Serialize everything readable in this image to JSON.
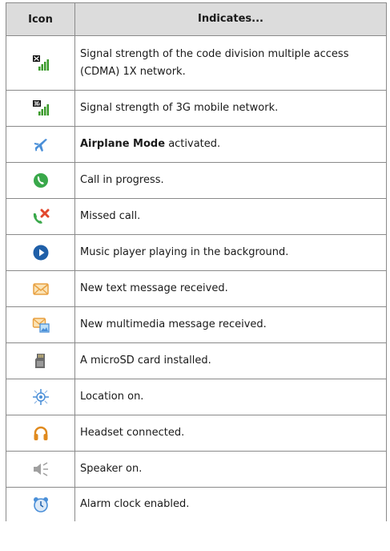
{
  "table": {
    "headers": {
      "icon": "Icon",
      "indicates": "Indicates..."
    },
    "rows": [
      {
        "icon": "cdma-1x-signal-icon",
        "text": "Signal strength of the code division multiple access (CDMA) 1X network."
      },
      {
        "icon": "3g-signal-icon",
        "text": "Signal strength of 3G mobile network."
      },
      {
        "icon": "airplane-mode-icon",
        "bold": "Airplane Mode",
        "text": " activated."
      },
      {
        "icon": "call-in-progress-icon",
        "text": "Call in progress."
      },
      {
        "icon": "missed-call-icon",
        "text": "Missed call."
      },
      {
        "icon": "music-playing-icon",
        "text": "Music player playing in the background."
      },
      {
        "icon": "text-message-icon",
        "text": "New text message received."
      },
      {
        "icon": "multimedia-message-icon",
        "text": "New multimedia message received."
      },
      {
        "icon": "microsd-card-icon",
        "text": "A microSD card installed."
      },
      {
        "icon": "location-icon",
        "text": "Location on."
      },
      {
        "icon": "headset-icon",
        "text": "Headset connected."
      },
      {
        "icon": "speaker-icon",
        "text": "Speaker on."
      },
      {
        "icon": "alarm-clock-icon",
        "text": "Alarm clock enabled."
      }
    ]
  },
  "colors": {
    "header_bg": "#dcdcdc",
    "border": "#8a8a8a",
    "signal_green": "#3a9a2a",
    "airplane_blue": "#4a8fd8",
    "call_green": "#39a84a",
    "missed_red": "#e2482e",
    "music_blue": "#1f5fa8",
    "message_orange": "#e8a040"
  }
}
